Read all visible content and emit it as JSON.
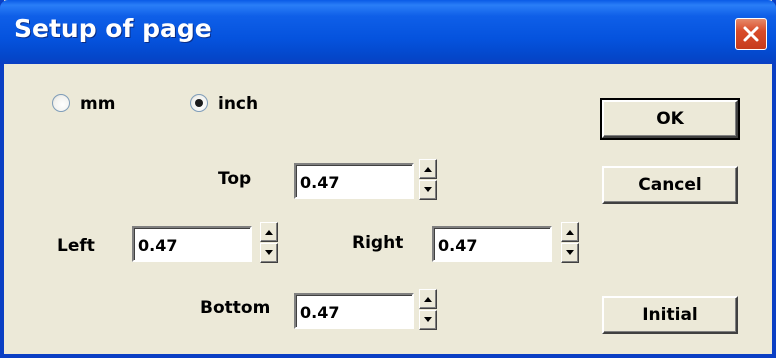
{
  "window": {
    "title": "Setup of page",
    "close_icon": "close-icon"
  },
  "units": {
    "options": [
      {
        "label": "mm",
        "checked": false
      },
      {
        "label": "inch",
        "checked": true
      }
    ]
  },
  "margins": {
    "top": {
      "label": "Top",
      "value": "0.47"
    },
    "left": {
      "label": "Left",
      "value": "0.47"
    },
    "right": {
      "label": "Right",
      "value": "0.47"
    },
    "bottom": {
      "label": "Bottom",
      "value": "0.47"
    }
  },
  "buttons": {
    "ok": "OK",
    "cancel": "Cancel",
    "initial": "Initial"
  },
  "colors": {
    "titlebar": "#0553de",
    "close_button": "#d94c2a",
    "dialog_background": "#ece9d8"
  }
}
